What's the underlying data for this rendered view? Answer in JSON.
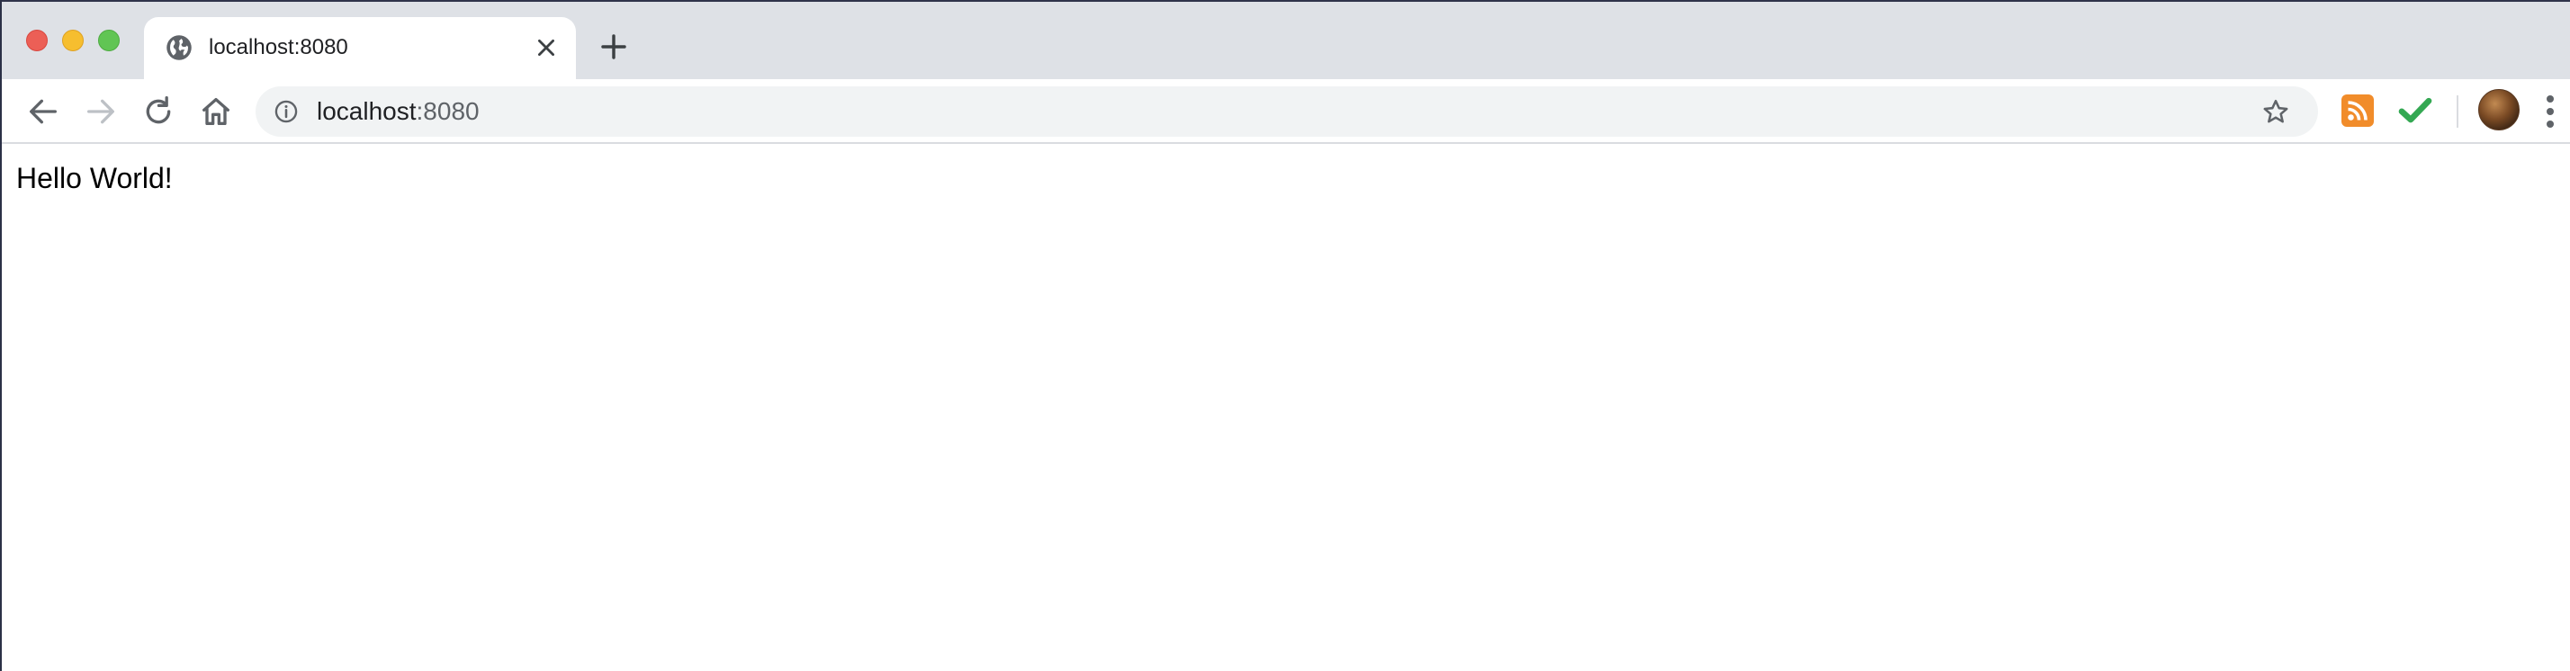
{
  "window": {
    "controls": [
      "close",
      "minimize",
      "maximize"
    ]
  },
  "tab": {
    "title": "localhost:8080",
    "favicon": "globe-icon",
    "close_icon": "close-icon"
  },
  "new_tab_icon": "plus-icon",
  "toolbar": {
    "back_icon": "back-arrow-icon",
    "forward_icon": "forward-arrow-icon",
    "reload_icon": "reload-icon",
    "home_icon": "home-icon",
    "info_icon": "info-icon",
    "url_host": "localhost",
    "url_port": ":8080",
    "bookmark_icon": "star-icon",
    "extensions": [
      "rss-icon",
      "checkmark-icon"
    ],
    "profile": "avatar",
    "menu_icon": "more-vertical-icon"
  },
  "page": {
    "text": "Hello World!"
  },
  "colors": {
    "tabstrip": "#dee1e6",
    "omnibox": "#f1f3f4",
    "rss": "#f18c2a",
    "check": "#34a853"
  }
}
